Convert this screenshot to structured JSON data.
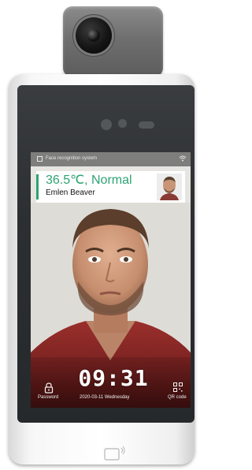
{
  "status_bar": {
    "title": "Face recognition system"
  },
  "result_card": {
    "temperature": "36.5℃, Normal",
    "person_name": "Emlen Beaver"
  },
  "footer": {
    "password_label": "Password",
    "time": "09:31",
    "date": "2020-03-11  Wednesday",
    "qr_label": "QR code"
  },
  "colors": {
    "accent_green": "#2ea372"
  },
  "icons": [
    "frame-icon",
    "wifi-icon",
    "lock-icon",
    "qr-code-icon",
    "card-reader-icon",
    "camera-lens-icon"
  ]
}
